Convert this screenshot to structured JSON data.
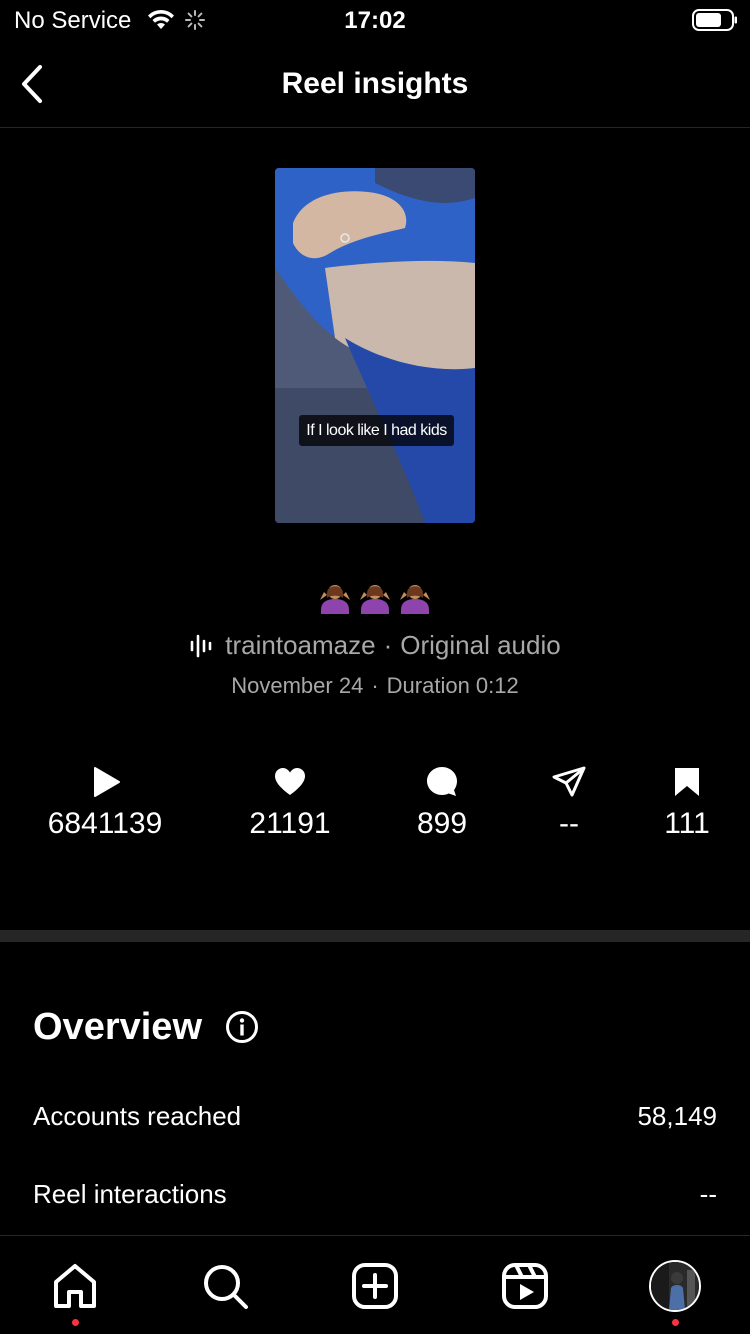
{
  "status_bar": {
    "carrier": "No Service",
    "time": "17:02"
  },
  "header": {
    "title": "Reel insights",
    "back_icon": "chevron-left-icon"
  },
  "reel": {
    "caption_overlay": "If I look like I had kids",
    "emojis": [
      "shrug-icon",
      "shrug-icon",
      "shrug-icon"
    ],
    "audio_user": "traintoamaze",
    "audio_label": "Original audio",
    "date": "November 24",
    "duration": "Duration 0:12",
    "separator": "·"
  },
  "metrics": [
    {
      "icon": "play-icon",
      "value": "6841139"
    },
    {
      "icon": "heart-icon",
      "value": "21191"
    },
    {
      "icon": "comment-icon",
      "value": "899"
    },
    {
      "icon": "share-icon",
      "value": "--"
    },
    {
      "icon": "bookmark-icon",
      "value": "111"
    }
  ],
  "overview": {
    "title": "Overview",
    "rows": [
      {
        "label": "Accounts reached",
        "value": "58,149"
      },
      {
        "label": "Reel interactions",
        "value": "--"
      }
    ]
  },
  "tab_bar": {
    "tabs": [
      "home-icon",
      "search-icon",
      "create-icon",
      "reels-icon",
      "profile-avatar"
    ],
    "notification_color": "#ff3040"
  },
  "colors": {
    "background": "#000000",
    "secondary_text": "#a8a8a8",
    "divider": "#262626"
  }
}
